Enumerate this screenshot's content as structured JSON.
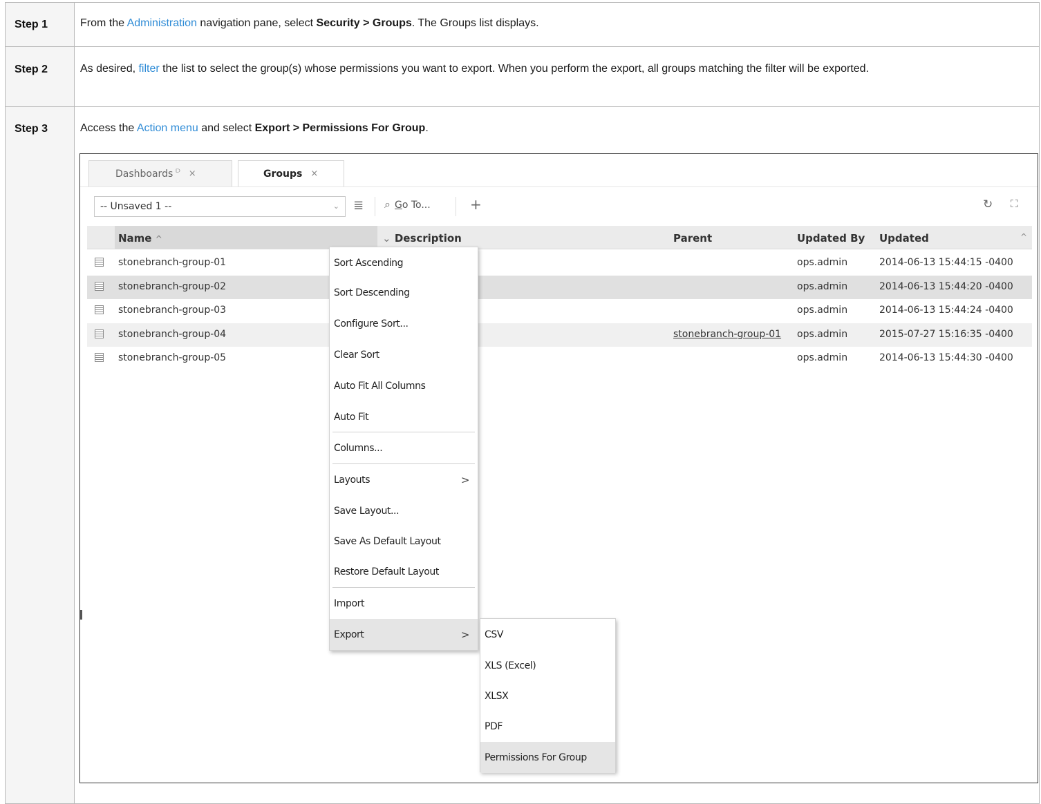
{
  "steps": [
    {
      "label": "Step 1",
      "text_parts": [
        "From the ",
        "Administration",
        " navigation pane, select ",
        "Security > Groups",
        ". The Groups list displays."
      ]
    },
    {
      "label": "Step 2",
      "text_parts": [
        "As desired, ",
        "filter",
        " the list to select the group(s) whose permissions you want to export. When you perform the export, all groups matching the filter will be exported."
      ]
    },
    {
      "label": "Step 3",
      "text_parts": [
        "Access the ",
        "Action menu",
        " and select ",
        "Export > Permissions For Group",
        "."
      ]
    }
  ],
  "app": {
    "tabs": [
      {
        "label": "Dashboards",
        "pin": "⫐",
        "close": "×"
      },
      {
        "label": "Groups",
        "close": "×"
      }
    ],
    "toolbar": {
      "layout_value": "-- Unsaved 1 --",
      "goto_underline": "G",
      "goto_rest": "o To...",
      "add_glyph": "+",
      "filter_glyph": "≣",
      "search_glyph": "⌕",
      "refresh_glyph": "↻",
      "expand_glyph": "⛶"
    },
    "grid": {
      "columns": [
        "Name",
        "Description",
        "Parent",
        "Updated By",
        "Updated"
      ],
      "name_sort_glyph": "^",
      "desc_glyph": "⌄",
      "collapse_glyph": "^",
      "rows": [
        {
          "name": "stonebranch-group-01",
          "parent": "",
          "updated_by": "ops.admin",
          "updated": "2014-06-13 15:44:15 -0400"
        },
        {
          "name": "stonebranch-group-02",
          "parent": "",
          "updated_by": "ops.admin",
          "updated": "2014-06-13 15:44:20 -0400"
        },
        {
          "name": "stonebranch-group-03",
          "parent": "",
          "updated_by": "ops.admin",
          "updated": "2014-06-13 15:44:24 -0400"
        },
        {
          "name": "stonebranch-group-04",
          "parent": "stonebranch-group-01",
          "updated_by": "ops.admin",
          "updated": "2015-07-27 15:16:35 -0400"
        },
        {
          "name": "stonebranch-group-05",
          "parent": "",
          "updated_by": "ops.admin",
          "updated": "2014-06-13 15:44:30 -0400"
        }
      ]
    },
    "context_menu": {
      "items": [
        "Sort Ascending",
        "Sort Descending",
        "Configure Sort...",
        "Clear Sort",
        "Auto Fit All Columns",
        "Auto Fit",
        "Columns...",
        "Layouts",
        "Save Layout...",
        "Save As Default Layout",
        "Restore Default Layout",
        "Import",
        "Export"
      ],
      "submenu_arrow": ">"
    },
    "export_menu": {
      "items": [
        "CSV",
        "XLS (Excel)",
        "XLSX",
        "PDF",
        "Permissions For Group"
      ]
    }
  }
}
